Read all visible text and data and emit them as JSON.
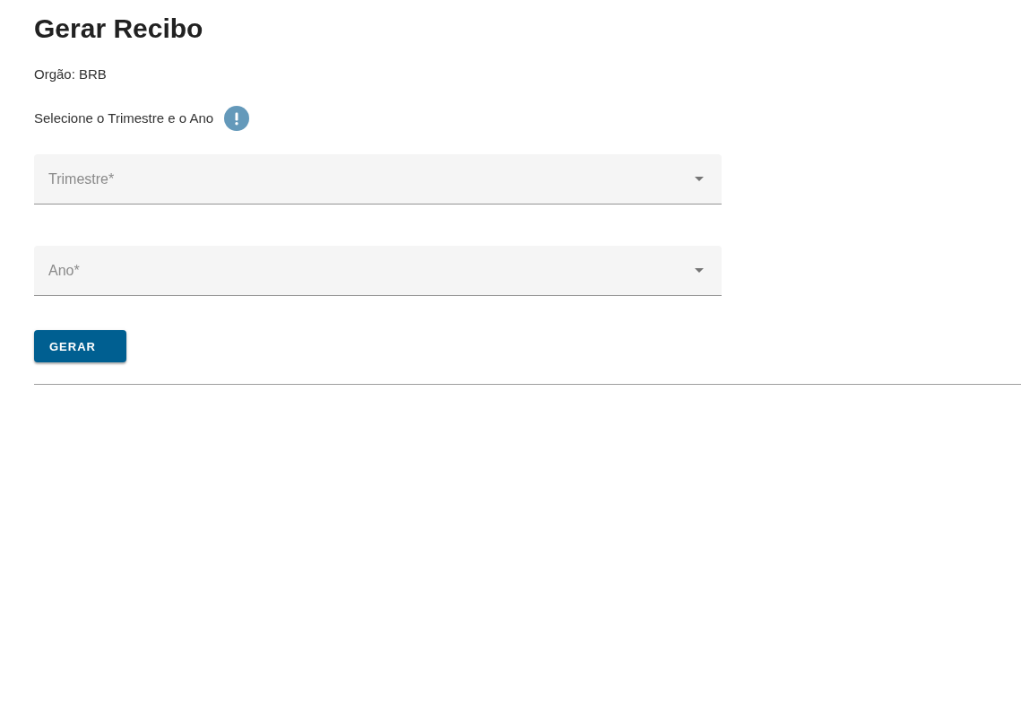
{
  "page": {
    "title": "Gerar Recibo",
    "organ": "Orgão: BRB",
    "instruction": "Selecione o Trimestre e o Ano"
  },
  "fields": [
    {
      "kind": "select",
      "label": "Trimestre*"
    },
    {
      "kind": "select",
      "label": "Ano*"
    }
  ],
  "buttons": [
    {
      "label": "GERAR"
    }
  ]
}
